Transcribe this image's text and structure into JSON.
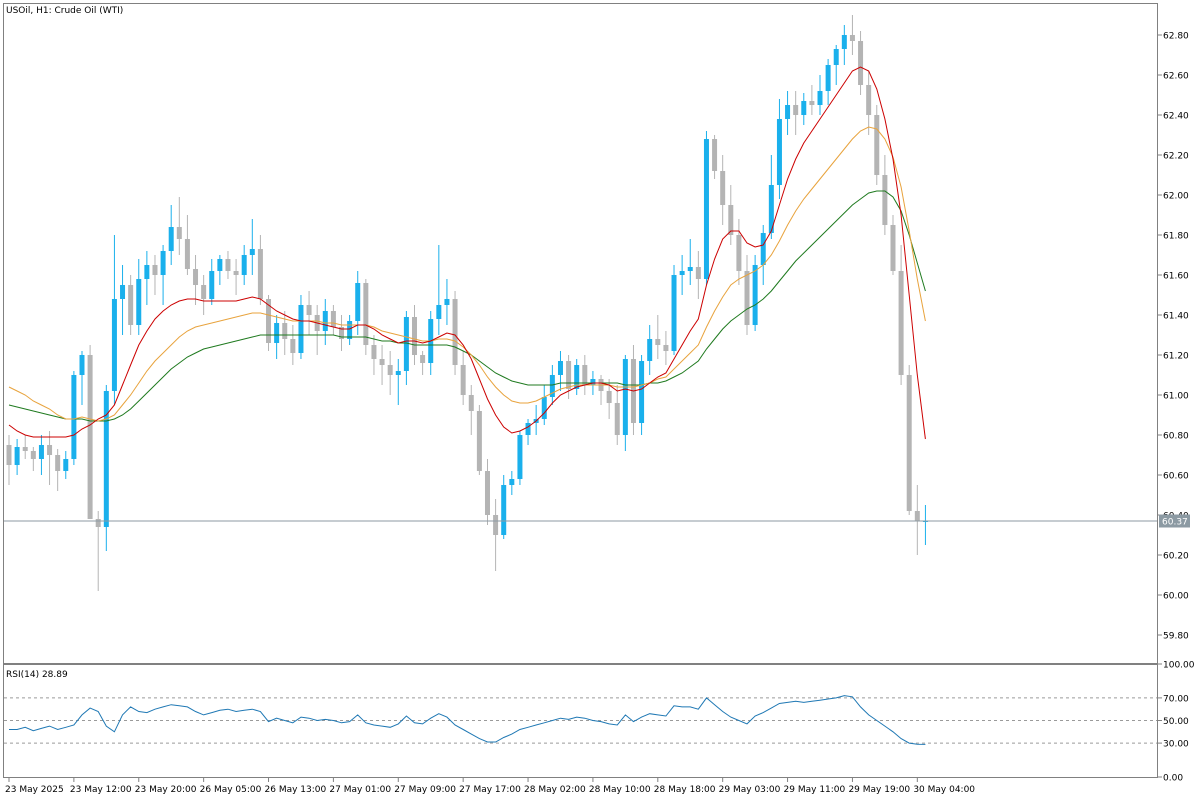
{
  "chart_data": {
    "type": "candlestick",
    "title": "USOil, H1:  Crude Oil (WTI)",
    "symbol": "USOil",
    "timeframe": "H1",
    "instrument": "Crude Oil (WTI)",
    "current_price": "60.37",
    "price_axis": {
      "ylim": [
        59.66,
        62.96
      ],
      "ticks": [
        "62.80",
        "62.60",
        "62.40",
        "62.20",
        "62.00",
        "61.80",
        "61.60",
        "61.40",
        "61.20",
        "61.00",
        "60.80",
        "60.60",
        "60.40",
        "60.20",
        "60.00",
        "59.80"
      ]
    },
    "time_axis": {
      "bar_count": 114,
      "labels": [
        {
          "text": "23 May 2025",
          "bar": 0
        },
        {
          "text": "23 May 12:00",
          "bar": 8
        },
        {
          "text": "23 May 20:00",
          "bar": 16
        },
        {
          "text": "26 May 05:00",
          "bar": 24
        },
        {
          "text": "26 May 13:00",
          "bar": 32
        },
        {
          "text": "27 May 01:00",
          "bar": 40
        },
        {
          "text": "27 May 09:00",
          "bar": 48
        },
        {
          "text": "27 May 17:00",
          "bar": 56
        },
        {
          "text": "28 May 02:00",
          "bar": 64
        },
        {
          "text": "28 May 10:00",
          "bar": 72
        },
        {
          "text": "28 May 18:00",
          "bar": 80
        },
        {
          "text": "29 May 03:00",
          "bar": 88
        },
        {
          "text": "29 May 11:00",
          "bar": 96
        },
        {
          "text": "29 May 19:00",
          "bar": 104
        },
        {
          "text": "30 May 04:00",
          "bar": 112
        }
      ]
    },
    "colors": {
      "bull": "#1ab0ec",
      "bear": "#b4b4b4",
      "ma_fast": "#cc0000",
      "ma_mid": "#e8a33d",
      "ma_slow": "#1f7a1f",
      "rsi": "#1f78b4",
      "price_line": "#8c9aa3"
    },
    "ohlc": [
      [
        60.75,
        60.8,
        60.55,
        60.65
      ],
      [
        60.65,
        60.78,
        60.6,
        60.74
      ],
      [
        60.74,
        60.8,
        60.68,
        60.72
      ],
      [
        60.72,
        60.74,
        60.62,
        60.68
      ],
      [
        60.68,
        60.8,
        60.6,
        60.75
      ],
      [
        60.75,
        60.82,
        60.55,
        60.7
      ],
      [
        60.7,
        60.73,
        60.52,
        60.62
      ],
      [
        60.62,
        60.72,
        60.58,
        60.68
      ],
      [
        60.68,
        61.12,
        60.65,
        61.1
      ],
      [
        61.1,
        61.22,
        60.95,
        61.2
      ],
      [
        61.2,
        61.25,
        60.38,
        60.38
      ],
      [
        60.38,
        60.42,
        60.02,
        60.34
      ],
      [
        60.34,
        61.05,
        60.22,
        61.02
      ],
      [
        61.02,
        61.8,
        60.95,
        61.48
      ],
      [
        61.48,
        61.65,
        61.3,
        61.55
      ],
      [
        61.55,
        61.6,
        61.3,
        61.35
      ],
      [
        61.35,
        61.68,
        61.3,
        61.58
      ],
      [
        61.58,
        61.72,
        61.45,
        61.65
      ],
      [
        61.65,
        61.7,
        61.5,
        61.6
      ],
      [
        61.6,
        61.75,
        61.45,
        61.72
      ],
      [
        61.72,
        61.95,
        61.65,
        61.84
      ],
      [
        61.84,
        61.99,
        61.7,
        61.78
      ],
      [
        61.78,
        61.9,
        61.6,
        61.63
      ],
      [
        61.63,
        61.7,
        61.45,
        61.55
      ],
      [
        61.55,
        61.6,
        61.4,
        61.48
      ],
      [
        61.48,
        61.68,
        61.45,
        61.62
      ],
      [
        61.62,
        61.7,
        61.55,
        61.68
      ],
      [
        61.68,
        61.72,
        61.58,
        61.62
      ],
      [
        61.62,
        61.68,
        61.5,
        61.6
      ],
      [
        61.6,
        61.75,
        61.55,
        61.7
      ],
      [
        61.7,
        61.88,
        61.6,
        61.73
      ],
      [
        61.73,
        61.8,
        61.45,
        61.48
      ],
      [
        61.48,
        61.5,
        61.22,
        61.26
      ],
      [
        61.26,
        61.4,
        61.18,
        61.36
      ],
      [
        61.36,
        61.42,
        61.2,
        61.28
      ],
      [
        61.28,
        61.35,
        61.15,
        61.21
      ],
      [
        61.21,
        61.5,
        61.18,
        61.45
      ],
      [
        61.45,
        61.52,
        61.3,
        61.4
      ],
      [
        61.4,
        61.45,
        61.2,
        61.32
      ],
      [
        61.32,
        61.48,
        61.25,
        61.42
      ],
      [
        61.42,
        61.45,
        61.3,
        61.34
      ],
      [
        61.34,
        61.4,
        61.22,
        61.28
      ],
      [
        61.28,
        61.4,
        61.25,
        61.37
      ],
      [
        61.37,
        61.62,
        61.3,
        61.56
      ],
      [
        61.56,
        61.58,
        61.2,
        61.25
      ],
      [
        61.25,
        61.3,
        61.1,
        61.18
      ],
      [
        61.18,
        61.25,
        61.05,
        61.15
      ],
      [
        61.15,
        61.22,
        61.0,
        61.1
      ],
      [
        61.1,
        61.18,
        60.95,
        61.12
      ],
      [
        61.12,
        61.42,
        61.05,
        61.39
      ],
      [
        61.39,
        61.45,
        61.15,
        61.2
      ],
      [
        61.2,
        61.22,
        61.1,
        61.16
      ],
      [
        61.16,
        61.42,
        61.1,
        61.38
      ],
      [
        61.38,
        61.75,
        61.3,
        61.45
      ],
      [
        61.45,
        61.58,
        61.35,
        61.48
      ],
      [
        61.48,
        61.52,
        61.1,
        61.15
      ],
      [
        61.15,
        61.22,
        60.95,
        61.0
      ],
      [
        61.0,
        61.05,
        60.8,
        60.92
      ],
      [
        60.92,
        60.95,
        60.6,
        60.62
      ],
      [
        60.62,
        60.68,
        60.35,
        60.4
      ],
      [
        60.4,
        60.48,
        60.12,
        60.3
      ],
      [
        60.3,
        60.6,
        60.28,
        60.55
      ],
      [
        60.55,
        60.62,
        60.5,
        60.58
      ],
      [
        60.58,
        60.82,
        60.55,
        60.8
      ],
      [
        60.8,
        60.88,
        60.75,
        60.86
      ],
      [
        60.86,
        60.95,
        60.8,
        60.88
      ],
      [
        60.88,
        61.05,
        60.85,
        60.99
      ],
      [
        60.99,
        61.15,
        60.95,
        61.1
      ],
      [
        61.1,
        61.22,
        61.02,
        61.17
      ],
      [
        61.17,
        61.2,
        60.98,
        61.03
      ],
      [
        61.03,
        61.18,
        61.0,
        61.15
      ],
      [
        61.15,
        61.2,
        61.0,
        61.05
      ],
      [
        61.05,
        61.12,
        61.0,
        61.08
      ],
      [
        61.08,
        61.1,
        60.95,
        61.02
      ],
      [
        61.02,
        61.08,
        60.88,
        60.96
      ],
      [
        60.96,
        61.05,
        60.75,
        60.8
      ],
      [
        60.8,
        61.2,
        60.72,
        61.18
      ],
      [
        61.18,
        61.25,
        60.8,
        60.86
      ],
      [
        60.86,
        61.2,
        60.8,
        61.17
      ],
      [
        61.17,
        61.35,
        61.1,
        61.28
      ],
      [
        61.28,
        61.4,
        61.18,
        61.25
      ],
      [
        61.25,
        61.32,
        61.15,
        61.22
      ],
      [
        61.22,
        61.65,
        61.2,
        61.6
      ],
      [
        61.6,
        61.7,
        61.5,
        61.62
      ],
      [
        61.62,
        61.78,
        61.55,
        61.64
      ],
      [
        61.64,
        61.72,
        61.48,
        61.58
      ],
      [
        61.58,
        62.32,
        61.55,
        62.28
      ],
      [
        62.28,
        62.3,
        62.08,
        62.12
      ],
      [
        62.12,
        62.2,
        61.85,
        61.95
      ],
      [
        61.95,
        62.05,
        61.75,
        61.8
      ],
      [
        61.8,
        61.88,
        61.55,
        61.62
      ],
      [
        61.62,
        61.7,
        61.3,
        61.35
      ],
      [
        61.35,
        61.7,
        61.32,
        61.65
      ],
      [
        61.65,
        61.85,
        61.55,
        61.81
      ],
      [
        61.81,
        62.2,
        61.78,
        62.05
      ],
      [
        62.05,
        62.48,
        61.98,
        62.38
      ],
      [
        62.38,
        62.52,
        62.3,
        62.45
      ],
      [
        62.45,
        62.52,
        62.3,
        62.4
      ],
      [
        62.4,
        62.51,
        62.35,
        62.47
      ],
      [
        62.47,
        62.55,
        62.4,
        62.45
      ],
      [
        62.45,
        62.6,
        62.4,
        62.52
      ],
      [
        62.52,
        62.68,
        62.45,
        62.65
      ],
      [
        62.65,
        62.75,
        62.55,
        62.73
      ],
      [
        62.73,
        62.85,
        62.65,
        62.8
      ],
      [
        62.8,
        62.9,
        62.7,
        62.77
      ],
      [
        62.77,
        62.82,
        62.5,
        62.55
      ],
      [
        62.55,
        62.62,
        62.3,
        62.4
      ],
      [
        62.4,
        62.45,
        62.05,
        62.1
      ],
      [
        62.1,
        62.2,
        61.8,
        61.85
      ],
      [
        61.85,
        61.9,
        61.6,
        61.62
      ],
      [
        61.62,
        61.75,
        61.05,
        61.1
      ],
      [
        61.1,
        61.15,
        60.4,
        60.42
      ],
      [
        60.42,
        60.55,
        60.2,
        60.37
      ],
      [
        60.37,
        60.45,
        60.25,
        60.37
      ]
    ],
    "ma_fast": [
      60.85,
      60.82,
      60.8,
      60.79,
      60.79,
      60.79,
      60.79,
      60.79,
      60.8,
      60.83,
      60.85,
      60.88,
      60.9,
      60.95,
      61.05,
      61.15,
      61.25,
      61.32,
      61.38,
      61.42,
      61.45,
      61.47,
      61.48,
      61.48,
      61.47,
      61.47,
      61.47,
      61.47,
      61.47,
      61.48,
      61.49,
      61.48,
      61.45,
      61.42,
      61.4,
      61.38,
      61.37,
      61.37,
      61.36,
      61.35,
      61.34,
      61.33,
      61.33,
      61.35,
      61.35,
      61.33,
      61.3,
      61.28,
      61.26,
      61.27,
      61.27,
      61.26,
      61.27,
      61.29,
      61.31,
      61.3,
      61.25,
      61.18,
      61.08,
      60.98,
      60.9,
      60.84,
      60.81,
      60.82,
      60.84,
      60.87,
      60.91,
      60.96,
      61.0,
      61.02,
      61.04,
      61.05,
      61.06,
      61.06,
      61.05,
      61.02,
      61.03,
      61.02,
      61.03,
      61.06,
      61.09,
      61.11,
      61.18,
      61.25,
      61.32,
      61.38,
      61.55,
      61.68,
      61.78,
      61.82,
      61.82,
      61.76,
      61.74,
      61.75,
      61.82,
      61.95,
      62.08,
      62.18,
      62.26,
      62.32,
      62.38,
      62.44,
      62.5,
      62.56,
      62.62,
      62.64,
      62.62,
      62.53,
      62.38,
      62.18,
      61.9,
      61.5,
      61.1,
      60.78
    ],
    "ma_mid": [
      61.04,
      61.02,
      61.0,
      60.97,
      60.95,
      60.93,
      60.9,
      60.88,
      60.88,
      60.89,
      60.88,
      60.87,
      60.88,
      60.9,
      60.95,
      61.0,
      61.06,
      61.12,
      61.17,
      61.21,
      61.25,
      61.29,
      61.32,
      61.34,
      61.35,
      61.36,
      61.37,
      61.38,
      61.39,
      61.4,
      61.41,
      61.41,
      61.4,
      61.39,
      61.38,
      61.37,
      61.37,
      61.37,
      61.37,
      61.36,
      61.36,
      61.35,
      61.35,
      61.35,
      61.35,
      61.34,
      61.32,
      61.31,
      61.3,
      61.29,
      61.28,
      61.27,
      61.27,
      61.28,
      61.28,
      61.27,
      61.24,
      61.2,
      61.15,
      61.09,
      61.04,
      61.0,
      60.97,
      60.96,
      60.96,
      60.97,
      60.99,
      61.01,
      61.03,
      61.04,
      61.05,
      61.05,
      61.05,
      61.05,
      61.05,
      61.04,
      61.04,
      61.04,
      61.05,
      61.06,
      61.08,
      61.09,
      61.13,
      61.17,
      61.21,
      61.25,
      61.34,
      61.42,
      61.49,
      61.55,
      61.58,
      61.6,
      61.62,
      61.65,
      61.7,
      61.77,
      61.85,
      61.92,
      61.98,
      62.03,
      62.08,
      62.13,
      62.18,
      62.23,
      62.28,
      62.32,
      62.34,
      62.33,
      62.28,
      62.19,
      62.04,
      61.82,
      61.58,
      61.37
    ],
    "ma_slow": [
      60.95,
      60.94,
      60.93,
      60.92,
      60.91,
      60.9,
      60.89,
      60.88,
      60.88,
      60.88,
      60.87,
      60.87,
      60.87,
      60.88,
      60.9,
      60.93,
      60.97,
      61.01,
      61.05,
      61.09,
      61.13,
      61.16,
      61.19,
      61.21,
      61.23,
      61.24,
      61.25,
      61.26,
      61.27,
      61.28,
      61.29,
      61.3,
      61.3,
      61.3,
      61.3,
      61.3,
      61.3,
      61.3,
      61.3,
      61.3,
      61.3,
      61.29,
      61.29,
      61.29,
      61.29,
      61.28,
      61.27,
      61.27,
      61.26,
      61.26,
      61.25,
      61.25,
      61.25,
      61.25,
      61.25,
      61.24,
      61.22,
      61.2,
      61.17,
      61.14,
      61.11,
      61.09,
      61.07,
      61.06,
      61.05,
      61.05,
      61.05,
      61.05,
      61.06,
      61.06,
      61.06,
      61.06,
      61.06,
      61.06,
      61.06,
      61.06,
      61.05,
      61.05,
      61.05,
      61.06,
      61.06,
      61.07,
      61.09,
      61.11,
      61.14,
      61.17,
      61.23,
      61.28,
      61.33,
      61.37,
      61.4,
      61.43,
      61.45,
      61.48,
      61.52,
      61.57,
      61.62,
      61.67,
      61.71,
      61.75,
      61.79,
      61.83,
      61.87,
      61.91,
      61.95,
      61.98,
      62.01,
      62.02,
      62.02,
      61.99,
      61.92,
      61.8,
      61.66,
      61.52
    ],
    "rsi": {
      "label": "RSI(14) 28.89",
      "levels": [
        "100.00",
        "70.00",
        "50.00",
        "30.00",
        "0.00"
      ],
      "ylim": [
        0,
        100
      ],
      "values": [
        42,
        42,
        44,
        41,
        43,
        45,
        42,
        44,
        46,
        55,
        61,
        58,
        45,
        40,
        55,
        62,
        58,
        57,
        60,
        62,
        64,
        63,
        62,
        58,
        55,
        57,
        59,
        60,
        58,
        59,
        60,
        58,
        49,
        52,
        50,
        48,
        53,
        52,
        50,
        51,
        50,
        48,
        49,
        55,
        48,
        46,
        45,
        44,
        47,
        54,
        48,
        47,
        52,
        56,
        53,
        46,
        42,
        38,
        34,
        31,
        31,
        35,
        38,
        42,
        44,
        46,
        48,
        50,
        52,
        51,
        53,
        52,
        50,
        49,
        47,
        46,
        55,
        49,
        53,
        56,
        55,
        54,
        63,
        62,
        62,
        60,
        70,
        64,
        58,
        53,
        50,
        47,
        54,
        57,
        61,
        65,
        66,
        67,
        66,
        67,
        68,
        69,
        70,
        72,
        71,
        62,
        55,
        50,
        45,
        40,
        34,
        30,
        29,
        28.89
      ]
    }
  }
}
